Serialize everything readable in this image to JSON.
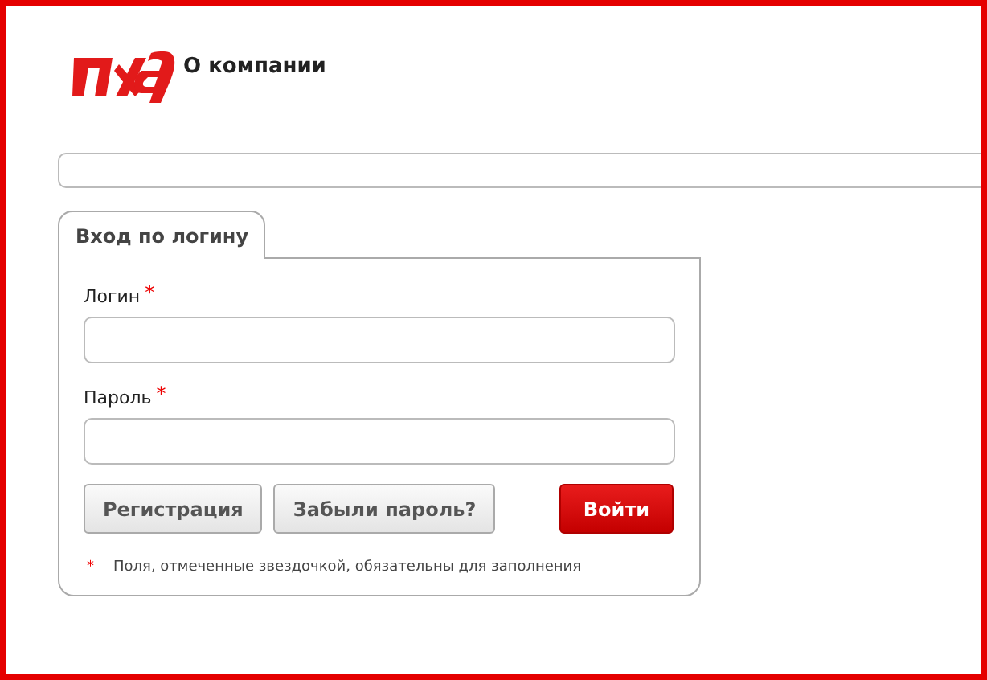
{
  "header": {
    "link": "О компании"
  },
  "tabs": [
    {
      "label": "Вход по логину",
      "selected": true
    }
  ],
  "fields": [
    {
      "label": "Логин",
      "required": true
    },
    {
      "label": "Пароль",
      "required": true
    }
  ],
  "buttons": [
    {
      "label": "Регистрация",
      "kind": "secondary"
    },
    {
      "label": "Забыли пароль?",
      "kind": "secondary"
    },
    {
      "label": "Войти",
      "kind": "primary"
    }
  ],
  "note": {
    "marker": "*",
    "text": "Поля, отмеченные звездочкой, обязательны для заполнения"
  }
}
